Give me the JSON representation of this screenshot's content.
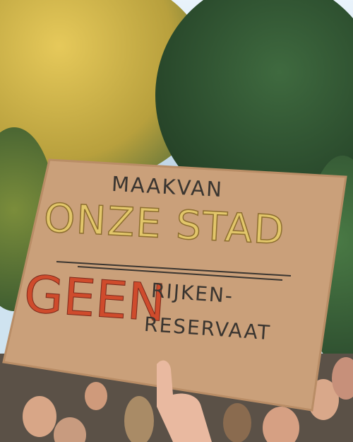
{
  "photo": {
    "sign": {
      "line1": "MAAKVAN",
      "line2": "ONZE STAD",
      "line3a": "GEEN",
      "line3b": "RIJKEN-",
      "line3c": "RESERVAAT"
    },
    "colors": {
      "cardboard": "#caa07a",
      "cardboard_edge": "#b98d66",
      "ink_dark": "#3a3530",
      "ink_yellow": "#e2c66a",
      "ink_orange": "#e58a35",
      "ink_red": "#cf4b2c",
      "foliage_yellow": "#d7b845",
      "foliage_green": "#2f4e2f",
      "crowd": "#5b5147"
    }
  }
}
